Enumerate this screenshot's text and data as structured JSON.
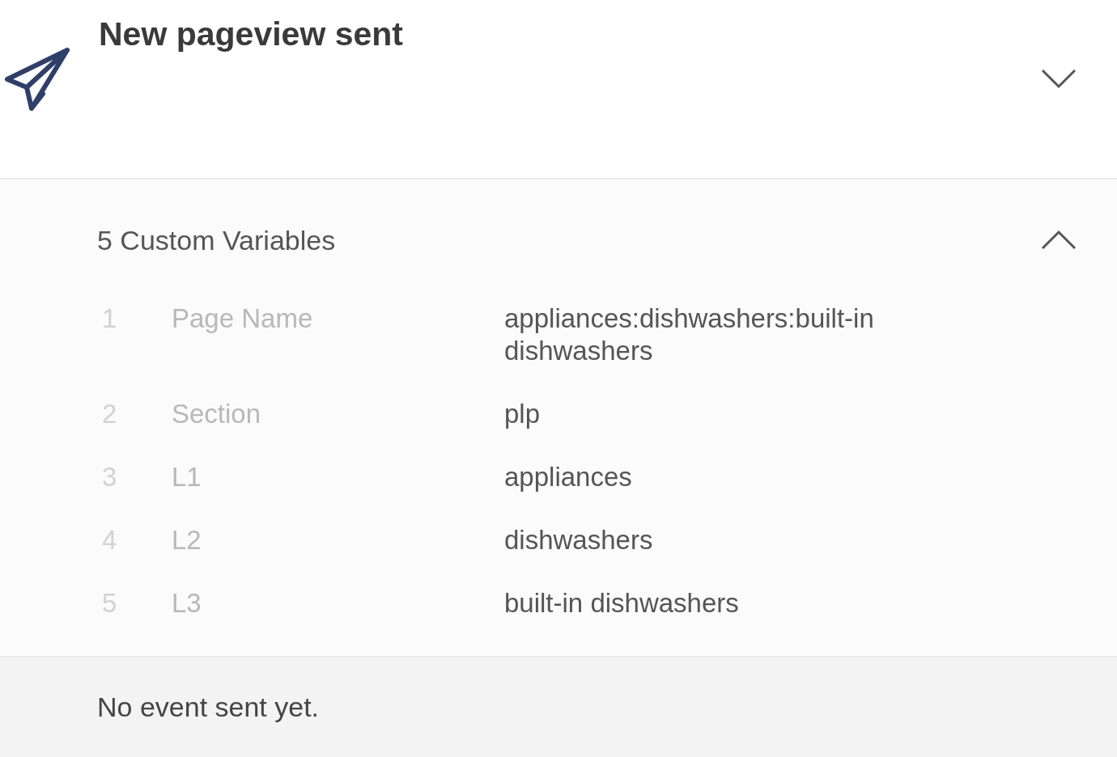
{
  "event": {
    "title": "New pageview sent",
    "expanded": false
  },
  "variables": {
    "heading": "5 Custom Variables",
    "expanded": true,
    "rows": [
      {
        "index": "1",
        "name": "Page Name",
        "value": "appliances:dishwashers:built-in dishwashers"
      },
      {
        "index": "2",
        "name": "Section",
        "value": "plp"
      },
      {
        "index": "3",
        "name": "L1",
        "value": "appliances"
      },
      {
        "index": "4",
        "name": "L2",
        "value": "dishwashers"
      },
      {
        "index": "5",
        "name": "L3",
        "value": "built-in dishwashers"
      }
    ]
  },
  "footer": {
    "message": "No event sent yet."
  }
}
